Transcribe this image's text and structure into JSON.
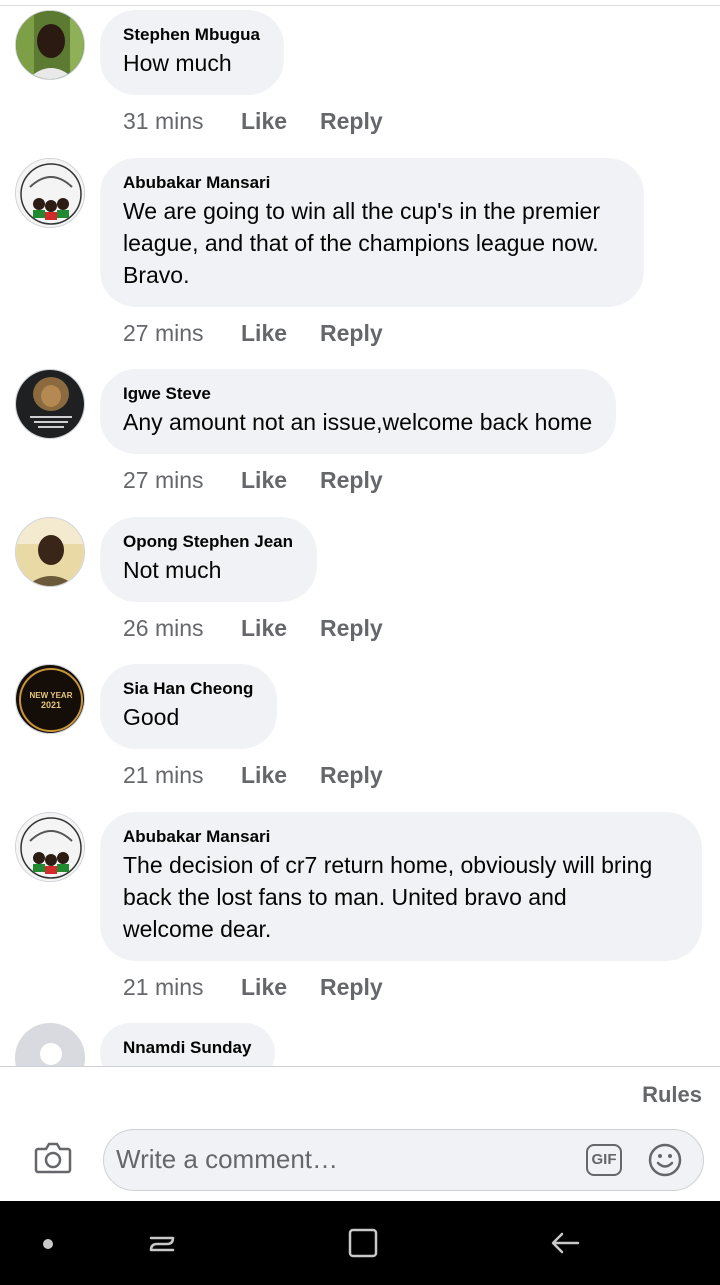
{
  "comments": [
    {
      "author": "Stephen Mbugua",
      "lines": [
        "How much"
      ],
      "time": "31 mins",
      "avatar": "man-outdoors-photo"
    },
    {
      "author": "Abubakar Mansari",
      "lines": [
        "We are going to win all the cup's in the premier",
        "league, and that of the champions league now.",
        "Bravo."
      ],
      "time": "27 mins",
      "avatar": "three-lions-badge"
    },
    {
      "author": "Igwe Steve",
      "lines": [
        "Any amount not an issue,welcome back home"
      ],
      "time": "27 mins",
      "avatar": "lion-quote"
    },
    {
      "author": "Opong Stephen Jean",
      "lines": [
        "Not much"
      ],
      "time": "26 mins",
      "avatar": "man-portrait"
    },
    {
      "author": "Sia Han Cheong",
      "lines": [
        "Good"
      ],
      "time": "21 mins",
      "avatar": "new-year-2021"
    },
    {
      "author": "Abubakar Mansari",
      "lines": [
        "The decision of cr7 return home, obviously will bring",
        "back the lost fans to man. United bravo and",
        "welcome dear."
      ],
      "time": "21 mins",
      "avatar": "three-lions-badge"
    },
    {
      "author": "Nnamdi Sunday",
      "lines": [],
      "time": "",
      "avatar": "default-avatar"
    }
  ],
  "actions": {
    "like": "Like",
    "reply": "Reply"
  },
  "footer": {
    "rules": "Rules",
    "placeholder": "Write a comment…",
    "gif": "GIF"
  },
  "avatar_text": {
    "new_year": "NEW YEAR",
    "year": "2021"
  },
  "colors": {
    "bubble": "#f0f2f5",
    "meta": "#65676b",
    "text": "#050505",
    "navbar": "#000000"
  }
}
